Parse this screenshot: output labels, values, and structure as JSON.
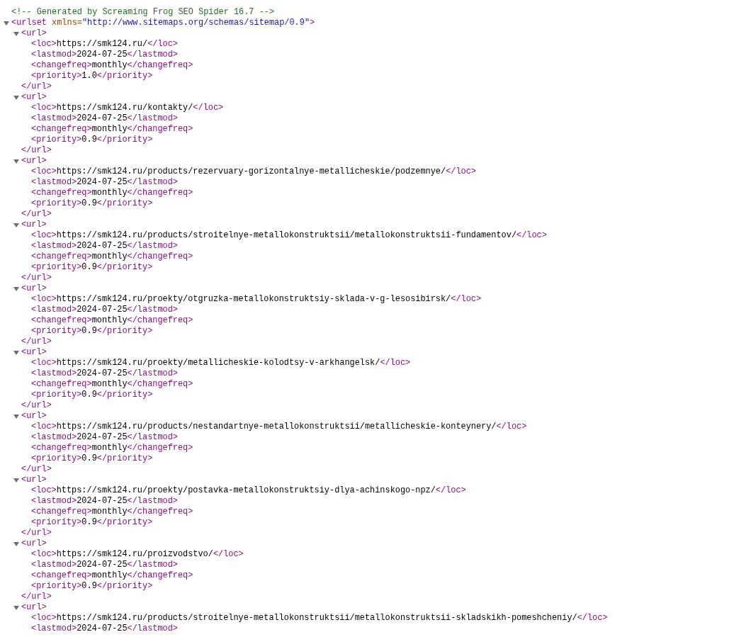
{
  "comment": "<!-- Generated by Screaming Frog SEO Spider 16.7 -->",
  "root": {
    "expanded": true,
    "open_start": "<urlset",
    "attr_name": "xmlns=",
    "attr_value": "\"http://www.sitemaps.org/schemas/sitemap/0.9\"",
    "open_end": ">"
  },
  "urls": [
    {
      "expanded": true,
      "open": "<url>",
      "close": "</url>",
      "fields": [
        {
          "open": "<loc>",
          "value": "https://smk124.ru/",
          "close": "</loc>"
        },
        {
          "open": "<lastmod>",
          "value": "2024-07-25",
          "close": "</lastmod>"
        },
        {
          "open": "<changefreq>",
          "value": "monthly",
          "close": "</changefreq>"
        },
        {
          "open": "<priority>",
          "value": "1.0",
          "close": "</priority>"
        }
      ]
    },
    {
      "expanded": true,
      "open": "<url>",
      "close": "</url>",
      "fields": [
        {
          "open": "<loc>",
          "value": "https://smk124.ru/kontakty/",
          "close": "</loc>"
        },
        {
          "open": "<lastmod>",
          "value": "2024-07-25",
          "close": "</lastmod>"
        },
        {
          "open": "<changefreq>",
          "value": "monthly",
          "close": "</changefreq>"
        },
        {
          "open": "<priority>",
          "value": "0.9",
          "close": "</priority>"
        }
      ]
    },
    {
      "expanded": true,
      "open": "<url>",
      "close": "</url>",
      "fields": [
        {
          "open": "<loc>",
          "value": "https://smk124.ru/products/rezervuary-gorizontalnye-metallicheskie/podzemnye/",
          "close": "</loc>"
        },
        {
          "open": "<lastmod>",
          "value": "2024-07-25",
          "close": "</lastmod>"
        },
        {
          "open": "<changefreq>",
          "value": "monthly",
          "close": "</changefreq>"
        },
        {
          "open": "<priority>",
          "value": "0.9",
          "close": "</priority>"
        }
      ]
    },
    {
      "expanded": true,
      "open": "<url>",
      "close": "</url>",
      "fields": [
        {
          "open": "<loc>",
          "value": "https://smk124.ru/products/stroitelnye-metallokonstruktsii/metallokonstruktsii-fundamentov/",
          "close": "</loc>"
        },
        {
          "open": "<lastmod>",
          "value": "2024-07-25",
          "close": "</lastmod>"
        },
        {
          "open": "<changefreq>",
          "value": "monthly",
          "close": "</changefreq>"
        },
        {
          "open": "<priority>",
          "value": "0.9",
          "close": "</priority>"
        }
      ]
    },
    {
      "expanded": true,
      "open": "<url>",
      "close": "</url>",
      "fields": [
        {
          "open": "<loc>",
          "value": "https://smk124.ru/proekty/otgruzka-metallokonstruktsiy-sklada-v-g-lesosibirsk/",
          "close": "</loc>"
        },
        {
          "open": "<lastmod>",
          "value": "2024-07-25",
          "close": "</lastmod>"
        },
        {
          "open": "<changefreq>",
          "value": "monthly",
          "close": "</changefreq>"
        },
        {
          "open": "<priority>",
          "value": "0.9",
          "close": "</priority>"
        }
      ]
    },
    {
      "expanded": true,
      "open": "<url>",
      "close": "</url>",
      "fields": [
        {
          "open": "<loc>",
          "value": "https://smk124.ru/proekty/metallicheskie-kolodtsy-v-arkhangelsk/",
          "close": "</loc>"
        },
        {
          "open": "<lastmod>",
          "value": "2024-07-25",
          "close": "</lastmod>"
        },
        {
          "open": "<changefreq>",
          "value": "monthly",
          "close": "</changefreq>"
        },
        {
          "open": "<priority>",
          "value": "0.9",
          "close": "</priority>"
        }
      ]
    },
    {
      "expanded": true,
      "open": "<url>",
      "close": "</url>",
      "fields": [
        {
          "open": "<loc>",
          "value": "https://smk124.ru/products/nestandartnye-metallokonstruktsii/metallicheskie-konteynery/",
          "close": "</loc>"
        },
        {
          "open": "<lastmod>",
          "value": "2024-07-25",
          "close": "</lastmod>"
        },
        {
          "open": "<changefreq>",
          "value": "monthly",
          "close": "</changefreq>"
        },
        {
          "open": "<priority>",
          "value": "0.9",
          "close": "</priority>"
        }
      ]
    },
    {
      "expanded": true,
      "open": "<url>",
      "close": "</url>",
      "fields": [
        {
          "open": "<loc>",
          "value": "https://smk124.ru/proekty/postavka-metallokonstruktsiy-dlya-achinskogo-npz/",
          "close": "</loc>"
        },
        {
          "open": "<lastmod>",
          "value": "2024-07-25",
          "close": "</lastmod>"
        },
        {
          "open": "<changefreq>",
          "value": "monthly",
          "close": "</changefreq>"
        },
        {
          "open": "<priority>",
          "value": "0.9",
          "close": "</priority>"
        }
      ]
    },
    {
      "expanded": true,
      "open": "<url>",
      "close": "</url>",
      "fields": [
        {
          "open": "<loc>",
          "value": "https://smk124.ru/proizvodstvo/",
          "close": "</loc>"
        },
        {
          "open": "<lastmod>",
          "value": "2024-07-25",
          "close": "</lastmod>"
        },
        {
          "open": "<changefreq>",
          "value": "monthly",
          "close": "</changefreq>"
        },
        {
          "open": "<priority>",
          "value": "0.9",
          "close": "</priority>"
        }
      ]
    },
    {
      "expanded": true,
      "open": "<url>",
      "fields": [
        {
          "open": "<loc>",
          "value": "https://smk124.ru/products/stroitelnye-metallokonstruktsii/metallokonstruktsii-skladskikh-pomeshcheniy/",
          "close": "</loc>"
        },
        {
          "open": "<lastmod>",
          "value": "2024-07-25",
          "close": "</lastmod>"
        }
      ]
    }
  ]
}
